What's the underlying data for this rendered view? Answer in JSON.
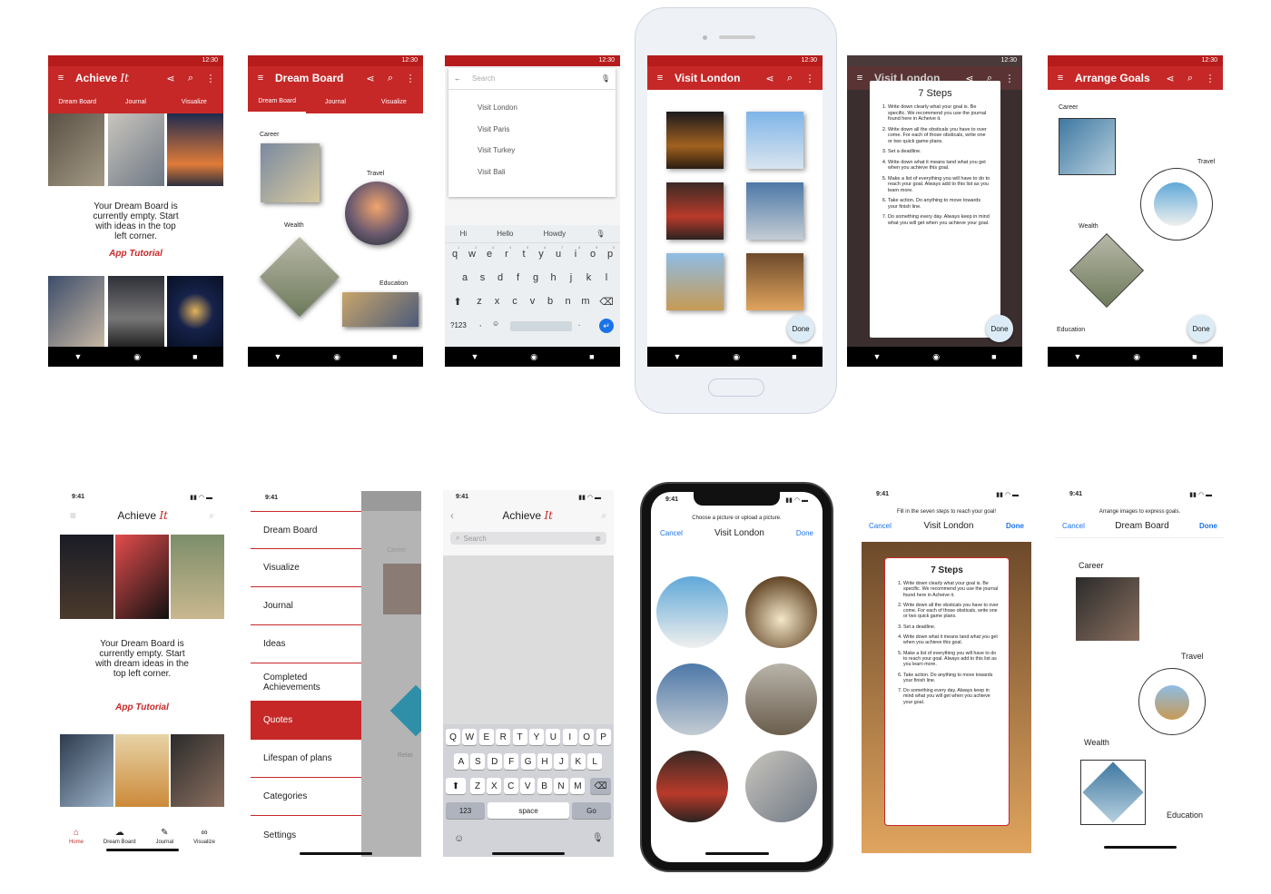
{
  "status_time_android": "12:30",
  "status_time_ios": "9:41",
  "android": {
    "s1": {
      "title": "Achieve",
      "logo": "It",
      "tabs": [
        "Dream Board",
        "Journal",
        "Visualize"
      ],
      "empty": [
        "Your Dream Board is",
        "currently empty. Start",
        "with ideas in the top",
        "left corner."
      ],
      "tutorial": "App Tutorial"
    },
    "s2": {
      "title": "Dream Board",
      "tabs": [
        "Dream Board",
        "Journal",
        "Visualize"
      ],
      "labels": {
        "career": "Career",
        "travel": "Travel",
        "wealth": "Wealth",
        "education": "Education"
      }
    },
    "s3": {
      "search_placeholder": "Search",
      "results": [
        "Visit London",
        "Visit Paris",
        "Visit Turkey",
        "Visit Bali"
      ],
      "suggestions": [
        "Hi",
        "Hello",
        "Howdy"
      ],
      "row1": [
        "q",
        "w",
        "e",
        "r",
        "t",
        "y",
        "u",
        "i",
        "o",
        "p"
      ],
      "row1_nums": [
        "1",
        "2",
        "3",
        "4",
        "5",
        "6",
        "7",
        "8",
        "9",
        "0"
      ],
      "row2": [
        "a",
        "s",
        "d",
        "f",
        "g",
        "h",
        "j",
        "k",
        "l"
      ],
      "row3": [
        "z",
        "x",
        "c",
        "v",
        "b",
        "n",
        "m"
      ],
      "sym": "?123",
      "comma": ","
    },
    "s4": {
      "title": "Visit London",
      "done": "Done"
    },
    "s5": {
      "title": "Visit London",
      "heading": "7 Steps",
      "steps": [
        "Write down clearly what your goal is. Be specific. We recommend you use the journal found here in Acheive it.",
        "Write down all the obsticals you have to over come. For each of those obsticals, write one or two quick game plans.",
        "Set a deadline.",
        "Write down what it means tand what you get when you achieve this goal.",
        "Make a list of everything you will have to do to reach your goal. Always add to this list as you learn more.",
        "Take action. Do anything to move towards your finish line.",
        "Do something every day. Always keep in mind what you will get when you achieve your goal."
      ],
      "done": "Done"
    },
    "s6": {
      "title": "Arrange Goals",
      "labels": {
        "career": "Career",
        "travel": "Travel",
        "wealth": "Wealth",
        "education": "Education"
      },
      "done": "Done"
    }
  },
  "ios": {
    "s1": {
      "title": "Achieve",
      "logo": "It",
      "empty": [
        "Your Dream Board is",
        "currently empty. Start",
        "with dream ideas in the",
        "top left corner."
      ],
      "tutorial": "App Tutorial",
      "tabs": [
        "Home",
        "Dream Board",
        "Journal",
        "Visualize"
      ]
    },
    "s2": {
      "menu": [
        "Dream Board",
        "Visualize",
        "Journal",
        "Ideas",
        "Completed Achievements",
        "Quotes",
        "Lifespan of plans",
        "Categories",
        "Settings"
      ],
      "active": "Quotes",
      "peek": {
        "career": "Career",
        "relat": "Relat"
      }
    },
    "s3": {
      "title": "Achieve",
      "logo": "It",
      "search_placeholder": "Search",
      "row1": [
        "Q",
        "W",
        "E",
        "R",
        "T",
        "Y",
        "U",
        "I",
        "O",
        "P"
      ],
      "row2": [
        "A",
        "S",
        "D",
        "F",
        "G",
        "H",
        "J",
        "K",
        "L"
      ],
      "row3": [
        "Z",
        "X",
        "C",
        "V",
        "B",
        "N",
        "M"
      ],
      "num": "123",
      "space": "space",
      "go": "Go"
    },
    "s4": {
      "hint": "Choose a picture or upload a picture.",
      "cancel": "Cancel",
      "title": "Visit London",
      "done": "Done"
    },
    "s5": {
      "hint": "Fill in the seven steps to reach your goal!",
      "cancel": "Cancel",
      "title": "Visit London",
      "done": "Done",
      "heading": "7 Steps",
      "steps": [
        "Write down clearly what your goal is. Be specific. We recommend you use the journal found here in Acheive it.",
        "Write down all the obsticals you have to over come. For each of those obsticals, write one or two quick game plans.",
        "Set a deadline.",
        "Write down what it means tand what you get when you achieve this goal.",
        "Make a list of everything you will have to do to reach your goal. Always add to this list as you learn more.",
        "Take action. Do anything to move towards your finish line.",
        "Do something every day. Always keep in mind what you will get when you achieve your goal."
      ]
    },
    "s6": {
      "hint": "Arrange images to express goals.",
      "cancel": "Cancel",
      "title": "Dream Board",
      "done": "Done",
      "labels": {
        "career": "Career",
        "travel": "Travel",
        "wealth": "Wealth",
        "education": "Education"
      }
    }
  },
  "colors": {
    "brand_red": "#c62828",
    "ios_blue": "#1a73e8"
  }
}
